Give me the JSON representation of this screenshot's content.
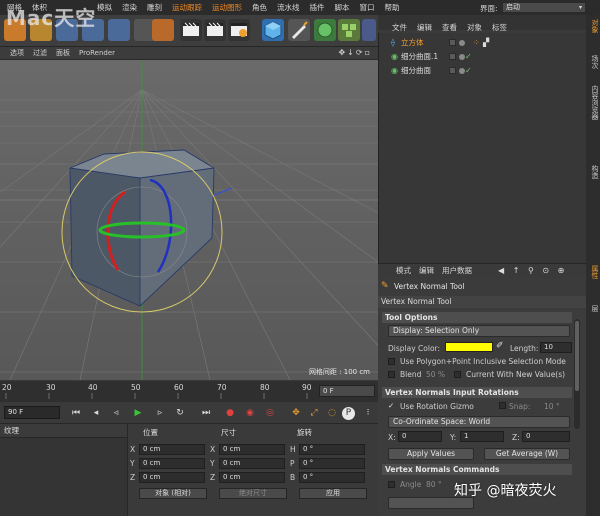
{
  "menubar": {
    "items": [
      "网格",
      "体积",
      "",
      "模拟",
      "渲染",
      "雕刻",
      "运动跟踪",
      "运动图形",
      "角色",
      "流水线",
      "插件",
      "脚本",
      "窗口",
      "帮助"
    ],
    "interface_label": "界面:",
    "interface_value": "启动"
  },
  "watermark": {
    "logo_text": "Mac天空"
  },
  "viewport": {
    "menu": [
      "选项",
      "过滤",
      "面板",
      "ProRender"
    ],
    "grid_spacing": "网格间距 : 100 cm"
  },
  "timeline": {
    "ticks": [
      "20",
      "30",
      "40",
      "50",
      "60",
      "70",
      "80",
      "90"
    ],
    "frame_end": "0 F"
  },
  "playback": {
    "current_frame": "90 F"
  },
  "material": {
    "header": "纹理"
  },
  "coords": {
    "headers": {
      "position": "位置",
      "size": "尺寸",
      "rotation": "旋转"
    },
    "rows": [
      {
        "axis": "X",
        "position": "0 cm",
        "size_axis": "X",
        "size": "0 cm",
        "rot_axis": "H",
        "rotation": "0 °"
      },
      {
        "axis": "Y",
        "position": "0 cm",
        "size_axis": "Y",
        "size": "0 cm",
        "rot_axis": "P",
        "rotation": "0 °"
      },
      {
        "axis": "Z",
        "position": "0 cm",
        "size_axis": "Z",
        "size": "0 cm",
        "rot_axis": "B",
        "rotation": "0 °"
      }
    ],
    "mode_select": "对象 (相对)",
    "size_select": "绝对尺寸",
    "apply_button": "应用"
  },
  "object_manager": {
    "menu": [
      "文件",
      "编辑",
      "查看",
      "对象",
      "标签"
    ],
    "objects": [
      {
        "name": "立方体",
        "color": "#f0a030",
        "selected": true
      },
      {
        "name": "细分曲面.1",
        "color": "#60c060",
        "selected": false
      },
      {
        "name": "细分曲面",
        "color": "#60c060",
        "selected": false
      }
    ]
  },
  "side_tabs": [
    "对象",
    "场次",
    "内容浏览器",
    "构造",
    "属性",
    "层"
  ],
  "attribute_manager": {
    "menu": [
      "模式",
      "编辑",
      "用户数据"
    ],
    "title": "Vertex Normal Tool",
    "subtitle": "Vertex Normal Tool",
    "tool_options_header": "Tool Options",
    "display_button": "Display: Selection Only",
    "display_color_label": "Display Color:",
    "display_color": "#ffff00",
    "length_label": "Length:",
    "length_value": "10",
    "use_polygon_label": "Use Polygon+Point Inclusive Selection Mode",
    "blend_label": "Blend",
    "blend_value": "50 %",
    "current_values_label": "Current With New Value(s)",
    "rotations_header": "Vertex Normals Input Rotations",
    "use_rotation_gizmo": "Use Rotation Gizmo",
    "snap_label": "Snap:",
    "snap_value": "10 °",
    "coord_space": "Co-Ordinate Space: World",
    "x_label": "X:",
    "x_value": "0",
    "y_label": "Y:",
    "y_value": "1",
    "z_label": "Z:",
    "z_value": "0",
    "apply_values": "Apply Values",
    "get_average": "Get Average (W)",
    "commands_header": "Vertex Normals Commands",
    "angle_label": "Angle",
    "angle_value": "80 °"
  },
  "overlay": {
    "zhihu": "知乎 @暗夜荧火"
  }
}
